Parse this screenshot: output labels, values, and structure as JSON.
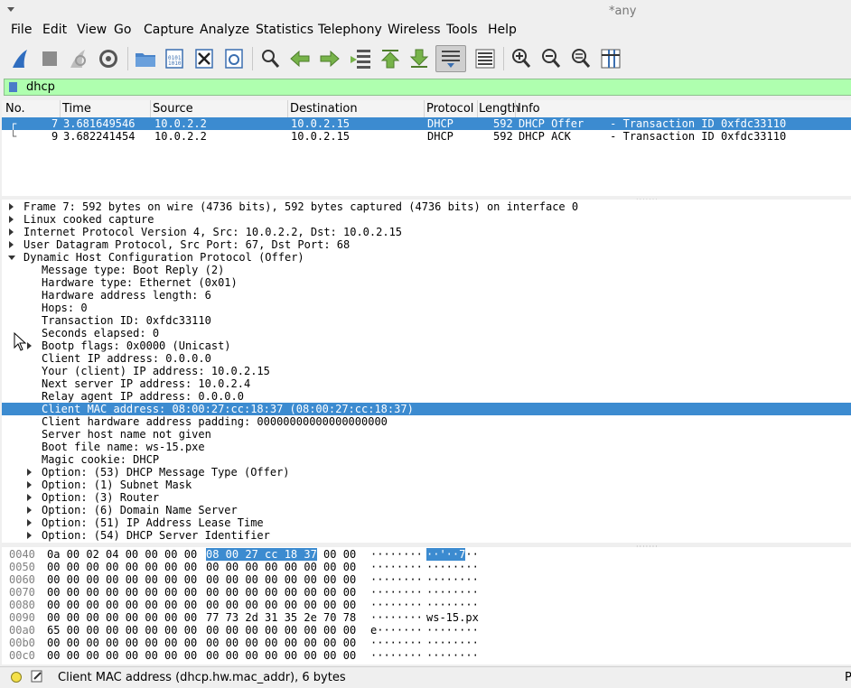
{
  "window": {
    "title": "*any"
  },
  "menu": [
    "File",
    "Edit",
    "View",
    "Go",
    "Capture",
    "Analyze",
    "Statistics",
    "Telephony",
    "Wireless",
    "Tools",
    "Help"
  ],
  "toolbar_icons": [
    "shark-fin-start-icon",
    "stop-capture-icon",
    "restart-capture-icon",
    "capture-options-icon",
    "open-file-icon",
    "save-file-icon",
    "close-file-icon",
    "reload-file-icon",
    "find-packet-icon",
    "go-back-icon",
    "go-forward-icon",
    "go-to-packet-icon",
    "go-first-icon",
    "go-last-icon",
    "autoscroll-icon",
    "colorize-icon",
    "zoom-in-icon",
    "zoom-out-icon",
    "zoom-normal-icon",
    "resize-columns-icon"
  ],
  "filter": {
    "value": "dhcp",
    "bg": "#afffaf"
  },
  "packet_list": {
    "columns": [
      "No.",
      "Time",
      "Source",
      "Destination",
      "Protocol",
      "Length",
      "Info"
    ],
    "rows": [
      {
        "no": "7",
        "time": "3.681649546",
        "source": "10.0.2.2",
        "destination": "10.0.2.15",
        "protocol": "DHCP",
        "length": "592",
        "info": "DHCP Offer    - Transaction ID 0xfdc33110",
        "selected": true
      },
      {
        "no": "9",
        "time": "3.682241454",
        "source": "10.0.2.2",
        "destination": "10.0.2.15",
        "protocol": "DHCP",
        "length": "592",
        "info": "DHCP ACK      - Transaction ID 0xfdc33110",
        "selected": false
      }
    ]
  },
  "details": [
    {
      "text": "Frame 7: 592 bytes on wire (4736 bits), 592 bytes captured (4736 bits) on interface 0",
      "level": 0,
      "expander": "collapsed"
    },
    {
      "text": "Linux cooked capture",
      "level": 0,
      "expander": "collapsed"
    },
    {
      "text": "Internet Protocol Version 4, Src: 10.0.2.2, Dst: 10.0.2.15",
      "level": 0,
      "expander": "collapsed"
    },
    {
      "text": "User Datagram Protocol, Src Port: 67, Dst Port: 68",
      "level": 0,
      "expander": "collapsed"
    },
    {
      "text": "Dynamic Host Configuration Protocol (Offer)",
      "level": 0,
      "expander": "expanded"
    },
    {
      "text": "Message type: Boot Reply (2)",
      "level": 1,
      "expander": "none"
    },
    {
      "text": "Hardware type: Ethernet (0x01)",
      "level": 1,
      "expander": "none"
    },
    {
      "text": "Hardware address length: 6",
      "level": 1,
      "expander": "none"
    },
    {
      "text": "Hops: 0",
      "level": 1,
      "expander": "none"
    },
    {
      "text": "Transaction ID: 0xfdc33110",
      "level": 1,
      "expander": "none"
    },
    {
      "text": "Seconds elapsed: 0",
      "level": 1,
      "expander": "none"
    },
    {
      "text": "Bootp flags: 0x0000 (Unicast)",
      "level": 1,
      "expander": "collapsed"
    },
    {
      "text": "Client IP address: 0.0.0.0",
      "level": 1,
      "expander": "none"
    },
    {
      "text": "Your (client) IP address: 10.0.2.15",
      "level": 1,
      "expander": "none"
    },
    {
      "text": "Next server IP address: 10.0.2.4",
      "level": 1,
      "expander": "none"
    },
    {
      "text": "Relay agent IP address: 0.0.0.0",
      "level": 1,
      "expander": "none"
    },
    {
      "text": "Client MAC address: 08:00:27:cc:18:37 (08:00:27:cc:18:37)",
      "level": 1,
      "expander": "none",
      "selected": true
    },
    {
      "text": "Client hardware address padding: 00000000000000000000",
      "level": 1,
      "expander": "none"
    },
    {
      "text": "Server host name not given",
      "level": 1,
      "expander": "none"
    },
    {
      "text": "Boot file name: ws-15.pxe",
      "level": 1,
      "expander": "none"
    },
    {
      "text": "Magic cookie: DHCP",
      "level": 1,
      "expander": "none"
    },
    {
      "text": "Option: (53) DHCP Message Type (Offer)",
      "level": 1,
      "expander": "collapsed"
    },
    {
      "text": "Option: (1) Subnet Mask",
      "level": 1,
      "expander": "collapsed"
    },
    {
      "text": "Option: (3) Router",
      "level": 1,
      "expander": "collapsed"
    },
    {
      "text": "Option: (6) Domain Name Server",
      "level": 1,
      "expander": "collapsed"
    },
    {
      "text": "Option: (51) IP Address Lease Time",
      "level": 1,
      "expander": "collapsed"
    },
    {
      "text": "Option: (54) DHCP Server Identifier",
      "level": 1,
      "expander": "collapsed"
    }
  ],
  "bytes": [
    {
      "offset": "0040",
      "hex1": "0a 00 02 04 00 00 00 00",
      "hex2": "08 00 27 cc 18 37 00 00",
      "ascii1": "········",
      "ascii2": "··'··7··",
      "hl_hex2": "08 00 27 cc 18 37",
      "hl_ascii2": "··'··7"
    },
    {
      "offset": "0050",
      "hex1": "00 00 00 00 00 00 00 00",
      "hex2": "00 00 00 00 00 00 00 00",
      "ascii1": "········",
      "ascii2": "········"
    },
    {
      "offset": "0060",
      "hex1": "00 00 00 00 00 00 00 00",
      "hex2": "00 00 00 00 00 00 00 00",
      "ascii1": "········",
      "ascii2": "········"
    },
    {
      "offset": "0070",
      "hex1": "00 00 00 00 00 00 00 00",
      "hex2": "00 00 00 00 00 00 00 00",
      "ascii1": "········",
      "ascii2": "········"
    },
    {
      "offset": "0080",
      "hex1": "00 00 00 00 00 00 00 00",
      "hex2": "00 00 00 00 00 00 00 00",
      "ascii1": "········",
      "ascii2": "········"
    },
    {
      "offset": "0090",
      "hex1": "00 00 00 00 00 00 00 00",
      "hex2": "77 73 2d 31 35 2e 70 78",
      "ascii1": "········",
      "ascii2": "ws-15.px"
    },
    {
      "offset": "00a0",
      "hex1": "65 00 00 00 00 00 00 00",
      "hex2": "00 00 00 00 00 00 00 00",
      "ascii1": "e·······",
      "ascii2": "········"
    },
    {
      "offset": "00b0",
      "hex1": "00 00 00 00 00 00 00 00",
      "hex2": "00 00 00 00 00 00 00 00",
      "ascii1": "········",
      "ascii2": "········"
    },
    {
      "offset": "00c0",
      "hex1": "00 00 00 00 00 00 00 00",
      "hex2": "00 00 00 00 00 00 00 00",
      "ascii1": "········",
      "ascii2": "········"
    }
  ],
  "status": {
    "message": "Client MAC address (dhcp.hw.mac_addr), 6 bytes",
    "right": "P"
  },
  "colors": {
    "selection": "#3c8bd0",
    "filter_valid": "#afffaf"
  }
}
